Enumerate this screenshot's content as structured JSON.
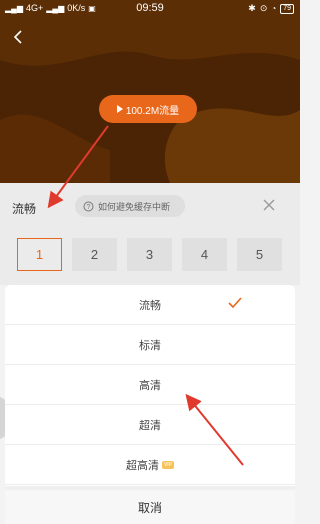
{
  "status": {
    "network": "4G+",
    "speed": "0K/s",
    "time": "09:59",
    "battery": "79"
  },
  "video": {
    "data_label": "100.2M流量"
  },
  "panel": {
    "title": "流畅",
    "tip": "如何避免缓存中断",
    "episodes": [
      "1",
      "2",
      "3",
      "4",
      "5"
    ],
    "selected_episode": "1"
  },
  "quality": {
    "options": [
      {
        "label": "流畅",
        "selected": true
      },
      {
        "label": "标清"
      },
      {
        "label": "高清"
      },
      {
        "label": "超清"
      },
      {
        "label": "超高清",
        "badge": "VIP"
      }
    ],
    "cancel_label": "取消"
  },
  "colors": {
    "accent": "#e8671a",
    "video_bg": "#4a2404",
    "arrow": "#e03a2e"
  }
}
